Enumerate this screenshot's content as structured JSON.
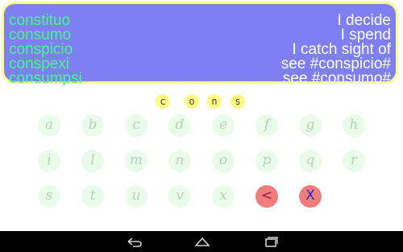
{
  "results": [
    {
      "latin": "constituo",
      "english": "I decide"
    },
    {
      "latin": "consumo",
      "english": "I spend"
    },
    {
      "latin": "conspicio",
      "english": "I catch sight of"
    },
    {
      "latin": "conspexi",
      "english": "see #conspicio#"
    },
    {
      "latin": "consumpsi",
      "english": "see #consumo#"
    }
  ],
  "prefix_letters": [
    "c",
    "o",
    "n",
    "s"
  ],
  "keyboard": {
    "rows": [
      [
        "a",
        "b",
        "c",
        "d",
        "e",
        "f",
        "g",
        "h"
      ],
      [
        "i",
        "l",
        "m",
        "n",
        "o",
        "p",
        "q",
        "r"
      ],
      [
        "s",
        "t",
        "u",
        "v",
        "x"
      ]
    ],
    "delete_label": "<",
    "clear_label": "X"
  },
  "colors": {
    "panel_bg": "#7f7ff4",
    "panel_border": "#fffb84",
    "latin_text": "#3dff7d",
    "english_text": "#ffffff",
    "key_bg": "#e9fbe9",
    "key_text": "#b5d2b6",
    "action_key_bg": "#f07c7c",
    "navbar_bg": "#000000"
  },
  "navbar": {
    "icons": [
      "back-icon",
      "home-icon",
      "recent-apps-icon"
    ]
  }
}
